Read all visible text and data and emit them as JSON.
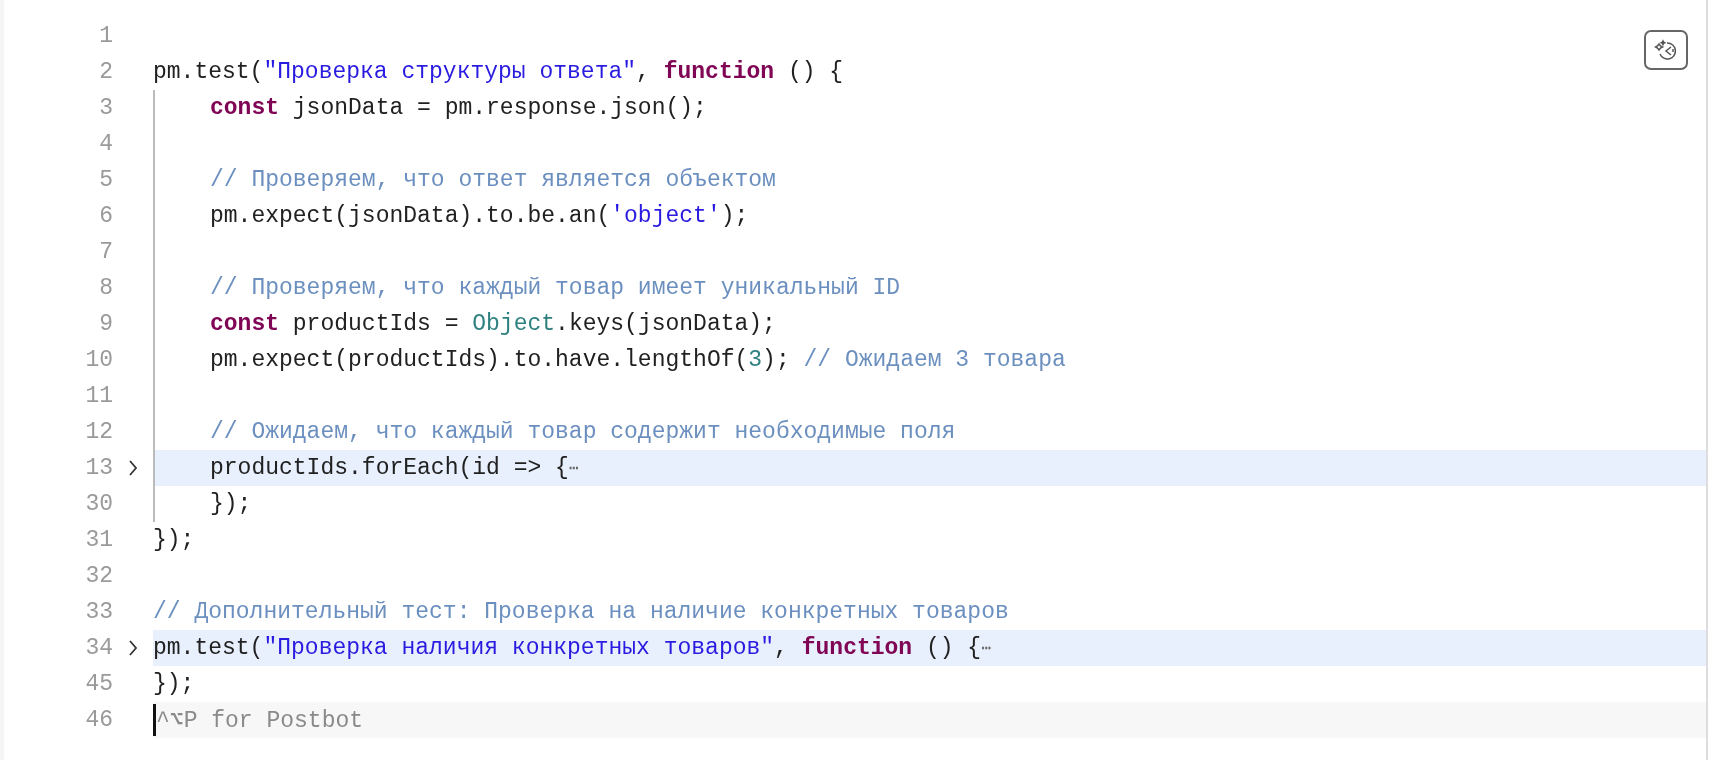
{
  "editor": {
    "lines": [
      {
        "number": "1",
        "guide": false,
        "highlighted": false,
        "active": false
      },
      {
        "number": "2",
        "guide": false,
        "highlighted": false,
        "active": false,
        "tokens": [
          {
            "kind": "plain",
            "text": "pm.test("
          },
          {
            "kind": "string",
            "text": "\"Проверка структуры ответа\""
          },
          {
            "kind": "plain",
            "text": ", "
          },
          {
            "kind": "keyword",
            "text": "function"
          },
          {
            "kind": "plain",
            "text": " () {"
          }
        ]
      },
      {
        "number": "3",
        "guide": true,
        "highlighted": false,
        "active": false,
        "tokens": [
          {
            "kind": "keyword",
            "text": "const"
          },
          {
            "kind": "plain",
            "text": " jsonData = pm.response.json();"
          }
        ]
      },
      {
        "number": "4",
        "guide": true,
        "highlighted": false,
        "active": false
      },
      {
        "number": "5",
        "guide": true,
        "highlighted": false,
        "active": false,
        "tokens": [
          {
            "kind": "comment",
            "text": "// Проверяем, что ответ является объектом"
          }
        ]
      },
      {
        "number": "6",
        "guide": true,
        "highlighted": false,
        "active": false,
        "tokens": [
          {
            "kind": "plain",
            "text": "pm.expect(jsonData).to.be.an("
          },
          {
            "kind": "string",
            "text": "'object'"
          },
          {
            "kind": "plain",
            "text": ");"
          }
        ]
      },
      {
        "number": "7",
        "guide": true,
        "highlighted": false,
        "active": false
      },
      {
        "number": "8",
        "guide": true,
        "highlighted": false,
        "active": false,
        "tokens": [
          {
            "kind": "comment",
            "text": "// Проверяем, что каждый товар имеет уникальный ID"
          }
        ]
      },
      {
        "number": "9",
        "guide": true,
        "highlighted": false,
        "active": false,
        "tokens": [
          {
            "kind": "keyword",
            "text": "const"
          },
          {
            "kind": "plain",
            "text": " productIds = "
          },
          {
            "kind": "class",
            "text": "Object"
          },
          {
            "kind": "plain",
            "text": ".keys(jsonData);"
          }
        ]
      },
      {
        "number": "10",
        "guide": true,
        "highlighted": false,
        "active": false,
        "tokens": [
          {
            "kind": "plain",
            "text": "pm.expect(productIds).to.have.lengthOf("
          },
          {
            "kind": "number",
            "text": "3"
          },
          {
            "kind": "plain",
            "text": "); "
          },
          {
            "kind": "comment",
            "text": "// Ожидаем 3 товара"
          }
        ]
      },
      {
        "number": "11",
        "guide": true,
        "highlighted": false,
        "active": false
      },
      {
        "number": "12",
        "guide": true,
        "highlighted": false,
        "active": false,
        "tokens": [
          {
            "kind": "comment",
            "text": "// Ожидаем, что каждый товар содержит необходимые поля"
          }
        ]
      },
      {
        "number": "13",
        "guide": true,
        "folded": true,
        "highlighted": true,
        "active": false,
        "tokens": [
          {
            "kind": "plain",
            "text": "productIds.forEach(id => {"
          },
          {
            "kind": "fold",
            "text": "⋯"
          }
        ]
      },
      {
        "number": "30",
        "guide": true,
        "highlighted": false,
        "active": false,
        "tokens": [
          {
            "kind": "plain",
            "text": "});"
          }
        ]
      },
      {
        "number": "31",
        "guide": false,
        "highlighted": false,
        "active": false,
        "tokens": [
          {
            "kind": "plain",
            "text": "});"
          }
        ]
      },
      {
        "number": "32",
        "guide": false,
        "highlighted": false,
        "active": false
      },
      {
        "number": "33",
        "guide": false,
        "highlighted": false,
        "active": false,
        "tokens": [
          {
            "kind": "comment",
            "text": "// Дополнительный тест: Проверка на наличие конкретных товаров"
          }
        ]
      },
      {
        "number": "34",
        "guide": false,
        "folded": true,
        "highlighted": true,
        "active": false,
        "tokens": [
          {
            "kind": "plain",
            "text": "pm.test("
          },
          {
            "kind": "string",
            "text": "\"Проверка наличия конкретных товаров\""
          },
          {
            "kind": "plain",
            "text": ", "
          },
          {
            "kind": "keyword",
            "text": "function"
          },
          {
            "kind": "plain",
            "text": " () {"
          },
          {
            "kind": "fold",
            "text": "⋯"
          }
        ]
      },
      {
        "number": "45",
        "guide": false,
        "highlighted": false,
        "active": false,
        "tokens": [
          {
            "kind": "plain",
            "text": "});"
          }
        ]
      },
      {
        "number": "46",
        "guide": false,
        "highlighted": false,
        "active": true,
        "placeholder": "^⌥P for Postbot"
      }
    ]
  }
}
